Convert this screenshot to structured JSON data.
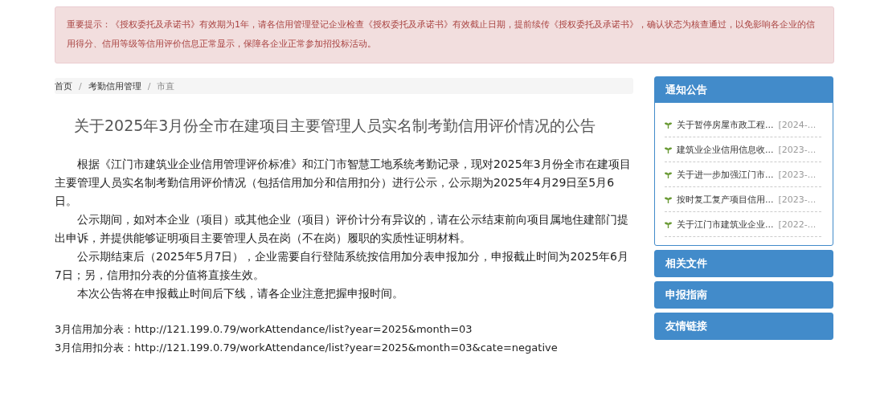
{
  "alert": {
    "text": "重要提示：《授权委托及承诺书》有效期为1年，请各信用管理登记企业检查《授权委托及承诺书》有效截止日期，提前续传《授权委托及承诺书》，确认状态为核查通过，以免影响各企业的信用得分、信用等级等信用评价信息正常显示，保障各企业正常参加招投标活动。"
  },
  "breadcrumb": {
    "separator": "/",
    "items": [
      {
        "label": "首页",
        "current": false
      },
      {
        "label": "考勤信用管理",
        "current": false
      },
      {
        "label": "市直",
        "current": true
      }
    ]
  },
  "article": {
    "title": "关于2025年3月份全市在建项目主要管理人员实名制考勤信用评价情况的公告",
    "paragraphs": [
      "根据《江门市建筑业企业信用管理评价标准》和江门市智慧工地系统考勤记录，现对2025年3月份全市在建项目主要管理人员实名制考勤信用评价情况（包括信用加分和信用扣分）进行公示，公示期为2025年4月29日至5月6日。",
      "公示期间，如对本企业（项目）或其他企业（项目）评价计分有异议的，请在公示结束前向项目属地住建部门提出申诉，并提供能够证明项目主要管理人员在岗（不在岗）履职的实质性证明材料。",
      "公示期结束后（2025年5月7日），企业需要自行登陆系统按信用加分表申报加分，申报截止时间为2025年6月7日；另，信用扣分表的分值将直接生效。",
      "本次公告将在申报截止时间后下线，请各企业注意把握申报时间。"
    ],
    "links": [
      "3月信用加分表：http://121.199.0.79/workAttendance/list?year=2025&month=03",
      "3月信用扣分表：http://121.199.0.79/workAttendance/list?year=2025&month=03&cate=negative"
    ]
  },
  "sidebar": [
    {
      "title": "通知公告",
      "expanded": true,
      "items": [
        {
          "title": "关于暂停房屋市政工程...",
          "date": "[2024-..."
        },
        {
          "title": "建筑业企业信用信息收...",
          "date": "[2023-..."
        },
        {
          "title": "关于进一步加强江门市...",
          "date": "[2023-..."
        },
        {
          "title": "按时复工复产项目信用...",
          "date": "[2023-..."
        },
        {
          "title": "关于江门市建筑业企业...",
          "date": "[2022-..."
        }
      ]
    },
    {
      "title": "相关文件",
      "expanded": false
    },
    {
      "title": "申报指南",
      "expanded": false
    },
    {
      "title": "友情链接",
      "expanded": false
    }
  ]
}
